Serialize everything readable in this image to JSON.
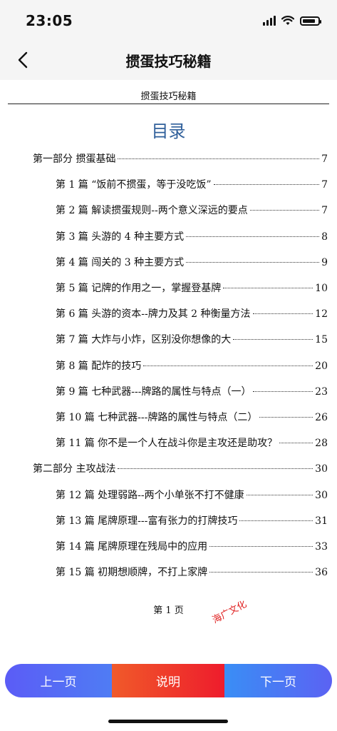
{
  "status": {
    "time": "23:05",
    "battery_level": 0.85
  },
  "nav": {
    "title": "掼蛋技巧秘籍",
    "back_icon": "chevron-left-icon"
  },
  "document": {
    "header": "掼蛋技巧秘籍",
    "toc_title": "目录",
    "toc_color": "#2f5f9a",
    "entries": [
      {
        "text": "第一部分  掼蛋基础",
        "page": "7",
        "level": 1
      },
      {
        "text": "第 1 篇  “饭前不掼蛋，等于没吃饭”",
        "page": "7",
        "level": 2
      },
      {
        "text": "第 2 篇  解读掼蛋规则--两个意义深远的要点",
        "page": "7",
        "level": 2
      },
      {
        "text": "第 3 篇  头游的 4 种主要方式",
        "page": "8",
        "level": 2
      },
      {
        "text": "第 4 篇  闯关的 3 种主要方式",
        "page": "9",
        "level": 2
      },
      {
        "text": "第 5 篇  记牌的作用之一，掌握登基牌",
        "page": "10",
        "level": 2
      },
      {
        "text": "第 6 篇  头游的资本--牌力及其 2 种衡量方法",
        "page": "12",
        "level": 2
      },
      {
        "text": "第 7 篇  大炸与小炸，区别没你想像的大",
        "page": "15",
        "level": 2
      },
      {
        "text": "第 8 篇  配炸的技巧",
        "page": "20",
        "level": 2
      },
      {
        "text": "第 9 篇  七种武器---牌路的属性与特点（一）",
        "page": "23",
        "level": 2
      },
      {
        "text": "第 10 篇  七种武器---牌路的属性与特点（二）",
        "page": "26",
        "level": 2
      },
      {
        "text": "第 11 篇  你不是一个人在战斗你是主攻还是助攻？",
        "page": "28",
        "level": 2
      },
      {
        "text": "第二部分  主攻战法",
        "page": "30",
        "level": 1
      },
      {
        "text": "第 12 篇  处理弱路--两个小单张不打不健康",
        "page": "30",
        "level": 2
      },
      {
        "text": "第 13 篇  尾牌原理---富有张力的打牌技巧",
        "page": "31",
        "level": 2
      },
      {
        "text": "第 14 篇  尾牌原理在残局中的应用",
        "page": "33",
        "level": 2
      },
      {
        "text": "第 15 篇  初期想顺牌，不打上家牌",
        "page": "36",
        "level": 2
      }
    ],
    "page_label": "第 1 页",
    "watermark": "海广文化",
    "watermark_color": "#e02020"
  },
  "bottom_bar": {
    "prev_label": "上一页",
    "explain_label": "说明",
    "next_label": "下一页",
    "prev_color": "#5b5cf6",
    "explain_color": "#ee1c2c",
    "next_color": "#3a8ef5"
  }
}
